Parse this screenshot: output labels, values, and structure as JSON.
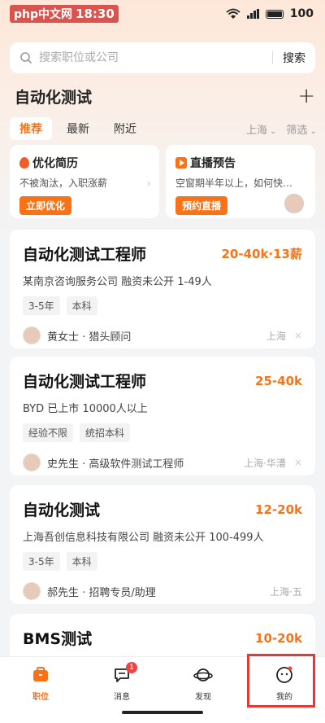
{
  "status": {
    "time": "18:30",
    "battery": "100",
    "watermark": "php中文网"
  },
  "search": {
    "placeholder": "搜索职位或公司",
    "button": "搜索"
  },
  "header": {
    "title": "自动化测试",
    "add_icon": "plus-icon"
  },
  "tabs": [
    {
      "label": "推荐",
      "active": true
    },
    {
      "label": "最新",
      "active": false
    },
    {
      "label": "附近",
      "active": false
    }
  ],
  "filters": {
    "city": "上海",
    "filter": "筛选"
  },
  "promos": [
    {
      "title": "优化简历",
      "desc": "不被淘汰，入职涨薪",
      "button": "立即优化",
      "icon": "flame-icon"
    },
    {
      "title": "直播预告",
      "desc": "空窗期半年以上，如何快…",
      "button": "预约直播",
      "icon": "play-icon"
    }
  ],
  "jobs": [
    {
      "title": "自动化测试工程师",
      "salary": "20-40k·13薪",
      "company": "某南京咨询服务公司  融资未公开  1-49人",
      "tags": [
        "3-5年",
        "本科"
      ],
      "recruiter": "黄女士 · 猎头顾问",
      "location": "上海",
      "close": "×"
    },
    {
      "title": "自动化测试工程师",
      "salary": "25-40k",
      "company": "BYD  已上市  10000人以上",
      "tags": [
        "经验不限",
        "统招本科"
      ],
      "recruiter": "史先生 · 高级软件测试工程师",
      "location": "上海·华漕",
      "close": "×"
    },
    {
      "title": "自动化测试",
      "salary": "12-20k",
      "company": "上海吾创信息科技有限公司  融资未公开  100-499人",
      "tags": [
        "3-5年",
        "本科"
      ],
      "recruiter": "郝先生 · 招聘专员/助理",
      "location": "上海·五",
      "close": ""
    },
    {
      "title": "BMS测试",
      "salary": "10-20k",
      "company": "",
      "tags": [],
      "recruiter": "",
      "location": "",
      "close": ""
    }
  ],
  "nav": [
    {
      "label": "职位",
      "icon": "briefcase-icon",
      "active": true,
      "badge": ""
    },
    {
      "label": "消息",
      "icon": "chat-icon",
      "active": false,
      "badge": "1"
    },
    {
      "label": "发现",
      "icon": "planet-icon",
      "active": false,
      "badge": ""
    },
    {
      "label": "我的",
      "icon": "profile-icon",
      "active": false,
      "badge": ""
    }
  ],
  "colors": {
    "accent": "#f97316",
    "badge": "#ef4444",
    "highlight": "#e53935"
  }
}
